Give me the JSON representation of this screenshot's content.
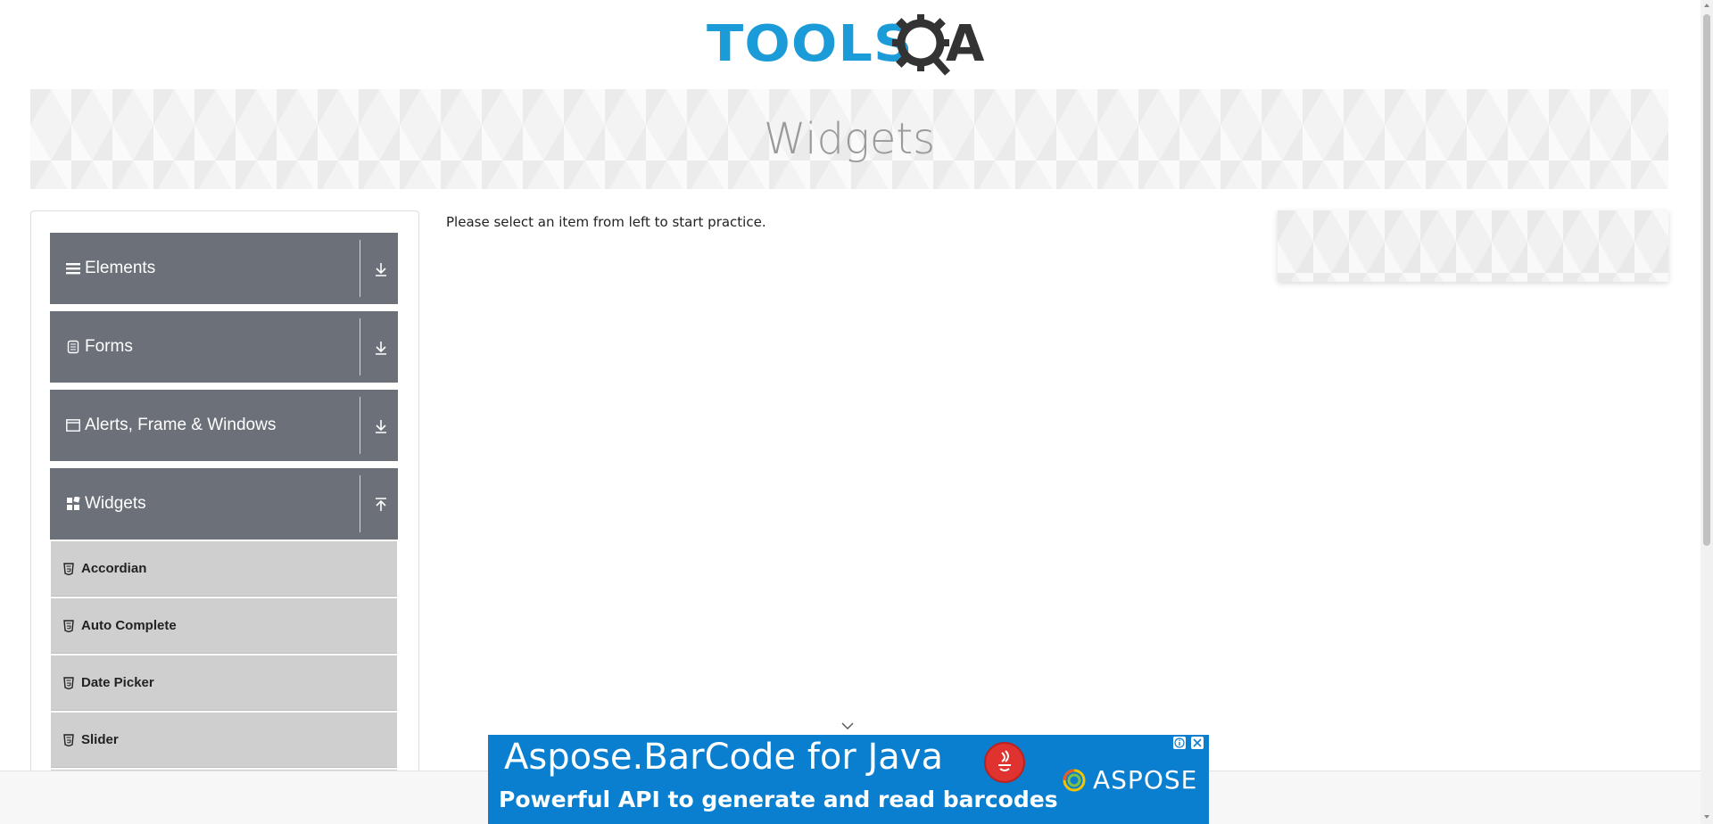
{
  "logo": {
    "text_tools": "TOOLS",
    "text_qa": "A",
    "brand_color": "#1b9bd7"
  },
  "banner": {
    "title": "Widgets"
  },
  "sidebar": {
    "groups": [
      {
        "label": "Elements",
        "icon": "menu-icon",
        "arrow": "download-icon"
      },
      {
        "label": "Forms",
        "icon": "document-icon",
        "arrow": "download-icon"
      },
      {
        "label": "Alerts, Frame & Windows",
        "icon": "window-icon",
        "arrow": "download-icon"
      },
      {
        "label": "Widgets",
        "icon": "grid-icon",
        "arrow": "upload-icon"
      }
    ],
    "items": [
      {
        "label": "Accordian",
        "icon": "html5-icon"
      },
      {
        "label": "Auto Complete",
        "icon": "html5-icon"
      },
      {
        "label": "Date Picker",
        "icon": "html5-icon"
      },
      {
        "label": "Slider",
        "icon": "html5-icon"
      }
    ]
  },
  "main": {
    "message": "Please select an item from left to start practice."
  },
  "ad": {
    "title": "Aspose.BarCode for Java",
    "subtitle": "Powerful API to generate and read barcodes",
    "brand": "ASPOSE",
    "background": "#0a7fd0"
  },
  "colors": {
    "group_bg": "#6b7079",
    "item_bg": "#cfcfcf"
  }
}
